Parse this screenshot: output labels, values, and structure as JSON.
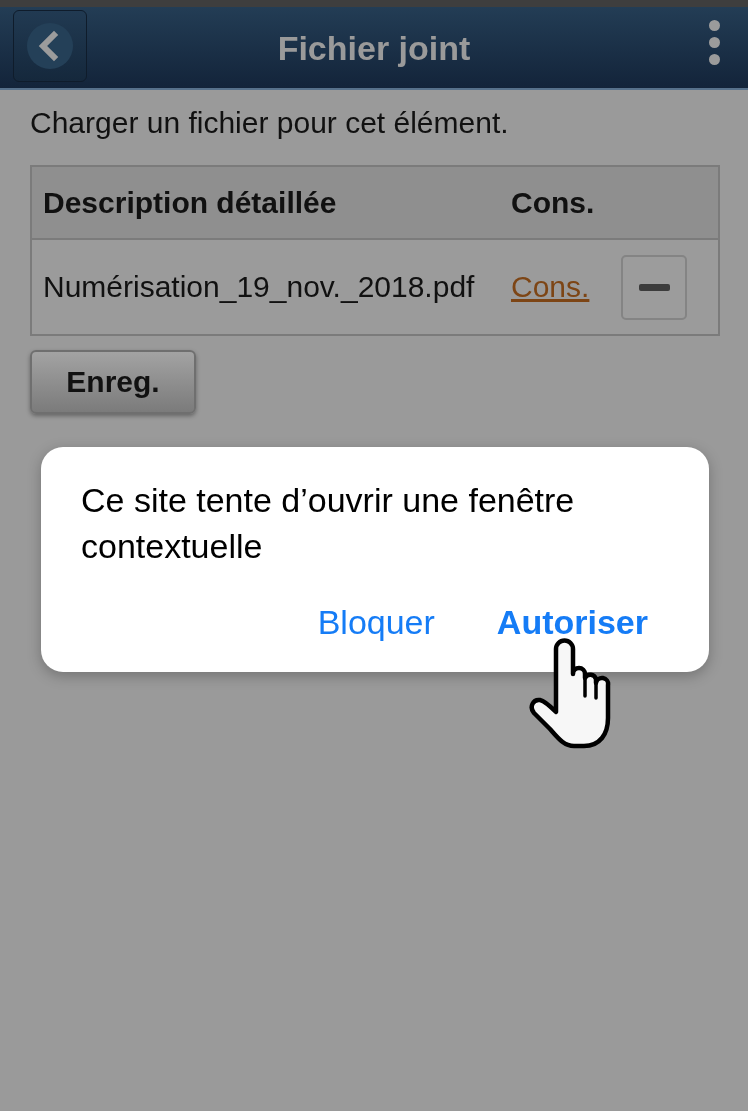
{
  "header": {
    "title": "Fichier joint"
  },
  "intro": "Charger un fichier pour cet élément.",
  "table": {
    "columns": [
      "Description détaillée",
      "Cons."
    ],
    "rows": [
      {
        "description": "Numérisation_19_nov._2018.pdf",
        "link": "Cons."
      }
    ]
  },
  "buttons": [
    "Enreg."
  ],
  "dialog": {
    "message": "Ce site tente d’ouvrir une fenêtre contextuelle",
    "actions": [
      {
        "label": "Bloquer",
        "kind": "cancel"
      },
      {
        "label": "Autoriser",
        "kind": "default"
      }
    ]
  }
}
